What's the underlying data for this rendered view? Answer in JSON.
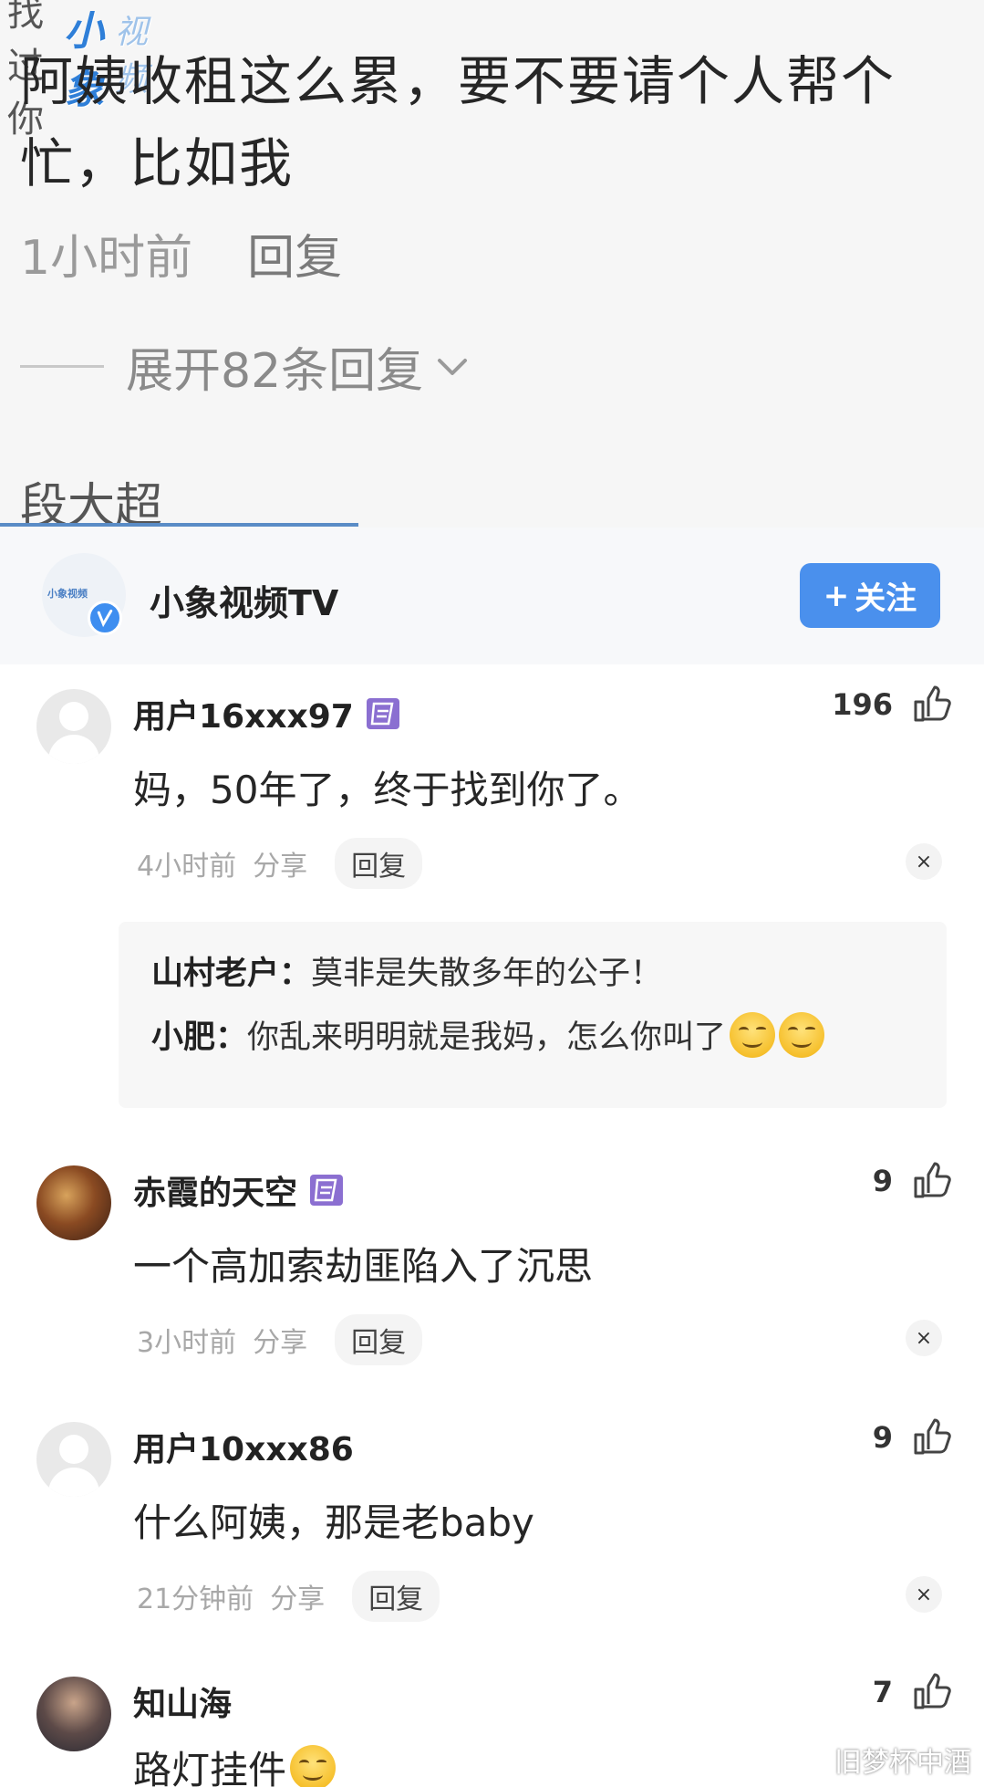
{
  "top": {
    "watermark_cut": "找过你",
    "watermark_logo": "小象",
    "watermark_logo2": "视频",
    "comment_text": "阿姨收租这么累，要不要请个人帮个忙，比如我",
    "time": "1小时前",
    "reply": "回复",
    "expand_label": "展开82条回复",
    "next_author": "段大超"
  },
  "channel": {
    "avatar_text": "小象视频",
    "name": "小象视频TV",
    "follow_label": "关注",
    "follow_plus": "+"
  },
  "comments": [
    {
      "user": "用户16xxx97",
      "likes": "196",
      "text": "妈，50年了，终于找到你了。",
      "time": "4小时前",
      "share": "分享",
      "reply": "回复",
      "close": "×",
      "replies": [
        {
          "author": "山村老户：",
          "text": "莫非是失散多年的公子！"
        },
        {
          "author": "小肥：",
          "text": "你乱来明明就是我妈，怎么你叫了"
        }
      ]
    },
    {
      "user": "赤霞的天空",
      "likes": "9",
      "text": "一个高加索劫匪陷入了沉思",
      "time": "3小时前",
      "share": "分享",
      "reply": "回复",
      "close": "×"
    },
    {
      "user": "用户10xxx86",
      "likes": "9",
      "text": "什么阿姨，那是老baby",
      "time": "21分钟前",
      "share": "分享",
      "reply": "回复",
      "close": "×"
    },
    {
      "user": "知山海",
      "likes": "7",
      "text": "路灯挂件"
    }
  ],
  "corner_watermark": "旧梦杯中酒",
  "colors": {
    "accent": "#4a90ed",
    "level_badge": "#8b6fd1",
    "meta_gray": "#a8a8a8"
  },
  "icons": [
    "chevron-down-icon",
    "like-icon",
    "close-icon",
    "level-badge-icon",
    "emoji-smirk-icon",
    "verified-badge-icon"
  ]
}
